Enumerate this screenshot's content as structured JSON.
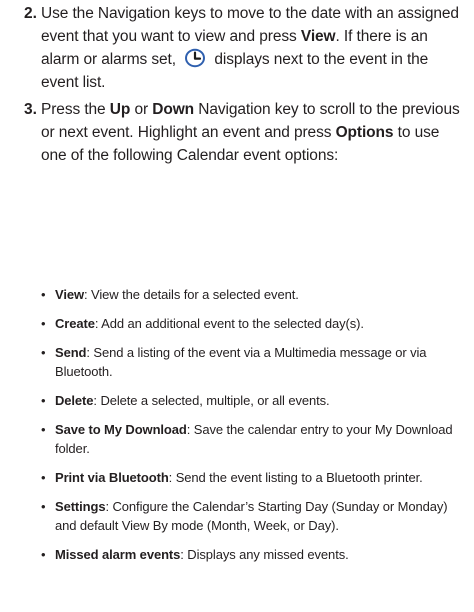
{
  "steps": [
    {
      "number": "2.",
      "text_1": "Use the Navigation keys to move to the date with an assigned event that you want to view and press ",
      "bold_1": "View",
      "text_2": ". If there is an alarm or alarms set, ",
      "icon": "alarm-clock-icon",
      "text_3": " displays next to the event in the event list."
    },
    {
      "number": "3.",
      "text_1": "Press the ",
      "bold_1": "Up",
      "text_2": " or ",
      "bold_2": "Down",
      "text_3": " Navigation key to scroll to the previous or next event. Highlight an event and press ",
      "bold_3": "Options",
      "text_4": " to use one of the following Calendar event options:"
    }
  ],
  "options": [
    {
      "term": "View",
      "desc": ": View the details for a selected event."
    },
    {
      "term": "Create",
      "desc": ": Add an additional event to the selected day(s)."
    },
    {
      "term": "Send",
      "desc": ": Send a listing of the event via a Multimedia message or via Bluetooth."
    },
    {
      "term": "Delete",
      "desc": ": Delete a selected, multiple, or all events."
    },
    {
      "term": "Save to My Download",
      "desc": ": Save the calendar entry to your My Download folder."
    },
    {
      "term": "Print via Bluetooth",
      "desc": ": Send the event listing to a Bluetooth printer."
    },
    {
      "term": "Settings",
      "desc": ": Configure the Calendar’s Starting Day (Sunday or Monday) and default View By mode (Month, Week, or Day)."
    },
    {
      "term": "Missed alarm events",
      "desc": ": Displays any missed events."
    }
  ],
  "bullet_char": "•",
  "colors": {
    "text": "#231f20",
    "icon_fill": "#2e5fae"
  }
}
